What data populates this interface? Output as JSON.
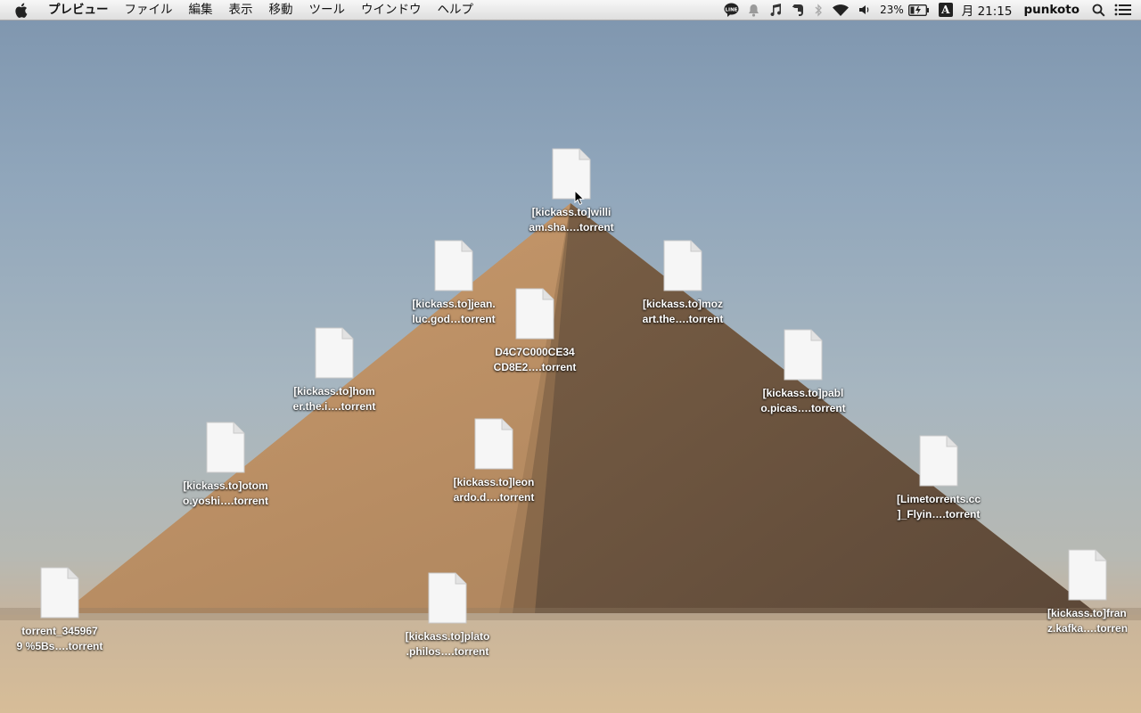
{
  "menubar": {
    "app_name": "プレビュー",
    "menus": [
      "ファイル",
      "編集",
      "表示",
      "移動",
      "ツール",
      "ウインドウ",
      "ヘルプ"
    ],
    "status": {
      "line_icon_text": "LINE",
      "battery": "23%",
      "input_indicator": "A",
      "clock": "月 21:15",
      "user": "punkoto"
    }
  },
  "desktop": {
    "files": [
      {
        "line1": "[kickass.to]willi",
        "line2": "am.sha….torrent"
      },
      {
        "line1": "[kickass.to]jean.",
        "line2": "luc.god…torrent"
      },
      {
        "line1": "[kickass.to]moz",
        "line2": "art.the….torrent"
      },
      {
        "line1": "D4C7C000CE34",
        "line2": "CD8E2….torrent"
      },
      {
        "line1": "[kickass.to]hom",
        "line2": "er.the.i….torrent"
      },
      {
        "line1": "[kickass.to]pabl",
        "line2": "o.picas….torrent"
      },
      {
        "line1": "[kickass.to]otom",
        "line2": "o.yoshi….torrent"
      },
      {
        "line1": "[kickass.to]leon",
        "line2": "ardo.d….torrent"
      },
      {
        "line1": "[Limetorrents.cc",
        "line2": "]_Flyin….torrent"
      },
      {
        "line1": "torrent_345967",
        "line2": "9 %5Bs….torrent"
      },
      {
        "line1": "[kickass.to]plato",
        "line2": ".philos….torrent"
      },
      {
        "line1": "[kickass.to]fran",
        "line2": "z.kafka….torrent"
      }
    ]
  }
}
